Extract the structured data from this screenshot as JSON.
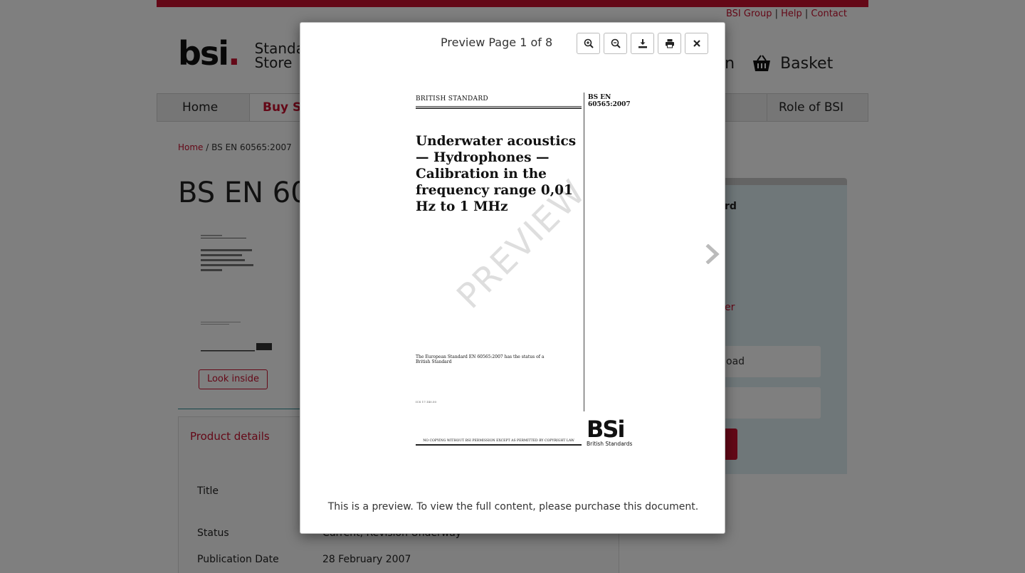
{
  "header": {
    "util_links": [
      "BSI Group",
      "Help",
      "Contact"
    ],
    "logo_text": "bsi",
    "logo_subtitle_line1": "Standards",
    "logo_subtitle_line2": "Store",
    "signin_fragment": "in",
    "basket_label": "Basket"
  },
  "nav": {
    "home": "Home",
    "buy": "Buy Sta",
    "role": "Role of BSI"
  },
  "breadcrumb": {
    "home": "Home",
    "separator": "/",
    "current": "BS EN 60565:2007"
  },
  "product": {
    "title_fragment": "BS EN 60",
    "look_inside": "Look inside",
    "details_header": "Product details",
    "rows": [
      {
        "label": "Title",
        "value": ""
      },
      {
        "label": "Status",
        "value": "Current, Revision Underway"
      },
      {
        "label": "Publication Date",
        "value": "28 February 2007"
      }
    ]
  },
  "side_panel": {
    "standard_fragment": "rd",
    "link_fragment": "er",
    "field1_fragment": "oad",
    "field2_fragment": ""
  },
  "modal": {
    "title": "Preview Page 1 of 8",
    "buttons": {
      "zoom_in": "zoom-in-icon",
      "zoom_out": "zoom-out-icon",
      "download": "download-icon",
      "print": "print-icon",
      "close": "close-icon"
    },
    "footer_note": "This is a preview. To view the full content, please purchase this document."
  },
  "document": {
    "header_label": "BRITISH STANDARD",
    "number_line1": "BS EN",
    "number_line2": "60565:2007",
    "title": "Underwater acoustics — Hydrophones — Calibration in the frequency range 0,01 Hz to 1 MHz",
    "status_text": "The European Standard EN 60565:2007 has the status of a British Standard",
    "ref_text": "ICS 17.140.50",
    "copyright": "NO COPYING WITHOUT BSI PERMISSION EXCEPT AS PERMITTED BY COPYRIGHT LAW",
    "logo_mark": "BSi",
    "logo_sub": "British Standards",
    "watermark": "PREVIEW"
  },
  "colors": {
    "brand_red": "#c8102e",
    "teal": "#2b8a95",
    "panel_blue": "#dfeef2"
  }
}
